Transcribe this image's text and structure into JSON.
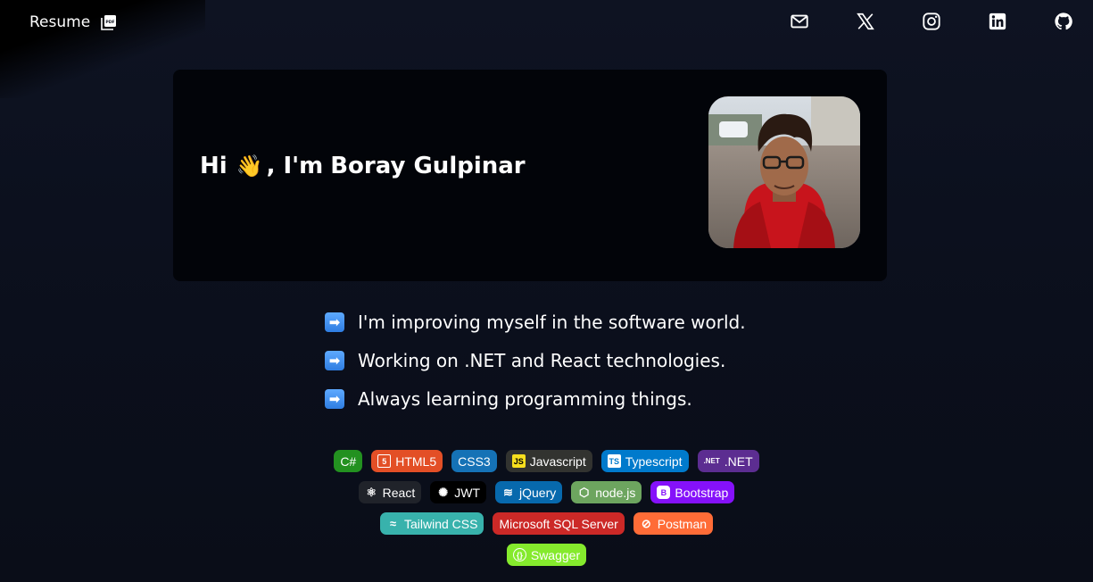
{
  "topbar": {
    "resume_label": "Resume",
    "resume_icon": "pdf-file-icon",
    "social": [
      {
        "name": "email-icon"
      },
      {
        "name": "x-twitter-icon"
      },
      {
        "name": "instagram-icon"
      },
      {
        "name": "linkedin-icon"
      },
      {
        "name": "github-icon"
      }
    ]
  },
  "hero": {
    "greeting_prefix": "Hi",
    "wave_emoji": "👋",
    "greeting_mid": ", I'm",
    "name": "Boray Gulpinar"
  },
  "bullets": [
    {
      "arrow": "➡",
      "text": "I'm improving myself in the software world."
    },
    {
      "arrow": "➡",
      "text": "Working on .NET and React technologies."
    },
    {
      "arrow": "➡",
      "text": "Always learning programming things."
    }
  ],
  "badges": {
    "row1": [
      {
        "label": "C#",
        "color": "#239120",
        "icon": ""
      },
      {
        "label": "HTML5",
        "color": "#e34f26",
        "icon": "5"
      },
      {
        "label": "CSS3",
        "color": "#1572b6",
        "icon": ""
      },
      {
        "label": "Javascript",
        "color": "#323330",
        "icon": "JS"
      },
      {
        "label": "Typescript",
        "color": "#007acc",
        "icon": "TS"
      },
      {
        "label": ".NET",
        "color": "#5c2d91",
        "icon": ".NET"
      }
    ],
    "row2": [
      {
        "label": "React",
        "color": "#20232a",
        "icon": "⚛"
      },
      {
        "label": "JWT",
        "color": "#000000",
        "icon": "✺"
      },
      {
        "label": "jQuery",
        "color": "#0769ad",
        "icon": "≋"
      },
      {
        "label": "node.js",
        "color": "#6da55f",
        "icon": "⬡"
      },
      {
        "label": "Bootstrap",
        "color": "#8511fa",
        "icon": "B"
      }
    ],
    "row3": [
      {
        "label": "Tailwind CSS",
        "color": "#38b2ac",
        "icon": "≈"
      },
      {
        "label": "Microsoft SQL Server",
        "color": "#cc2927",
        "icon": ""
      },
      {
        "label": "Postman",
        "color": "#ff6c37",
        "icon": "⊘"
      }
    ],
    "row4": [
      {
        "label": "Swagger",
        "color": "#85ea2d",
        "icon": "{}"
      }
    ]
  }
}
